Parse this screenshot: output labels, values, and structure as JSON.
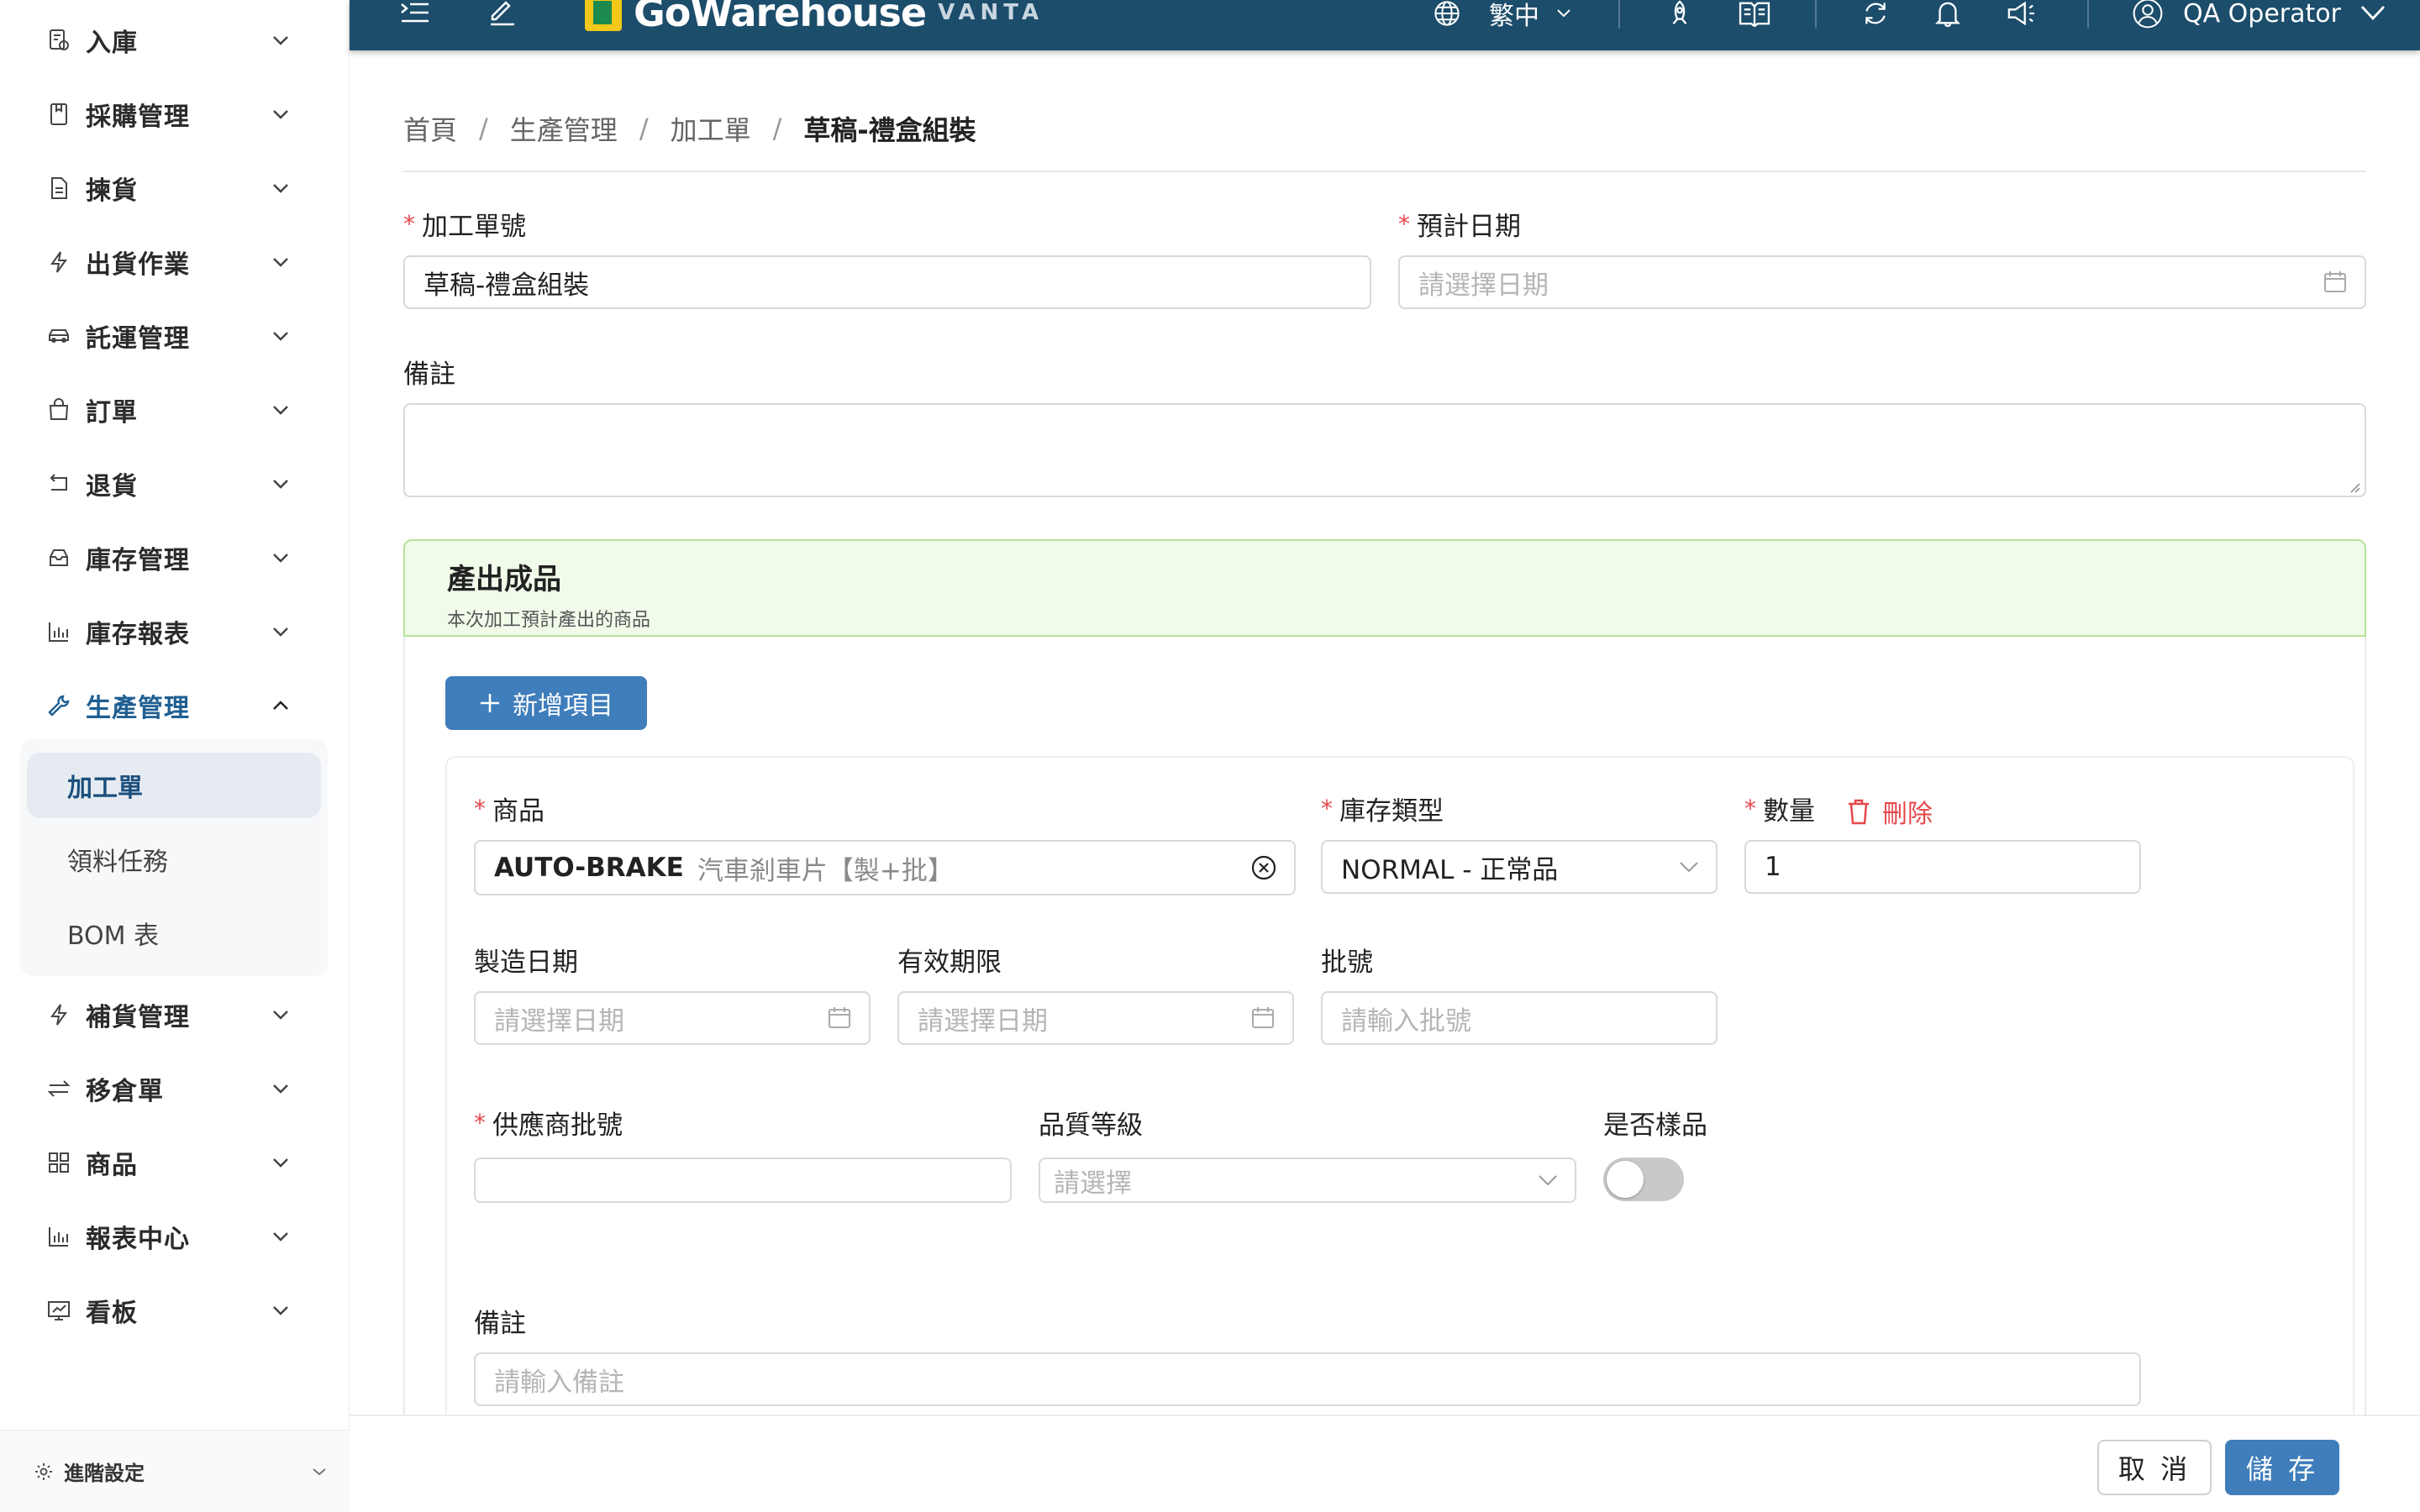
{
  "brand": {
    "name": "GoWarehouse",
    "sub": "VANTA"
  },
  "header": {
    "language": "繁中",
    "user": "QA Operator"
  },
  "sidebar": {
    "items": [
      {
        "label": "入庫",
        "icon": "inbound-icon"
      },
      {
        "label": "採購管理",
        "icon": "purchase-icon"
      },
      {
        "label": "揀貨",
        "icon": "picking-doc-icon"
      },
      {
        "label": "出貨作業",
        "icon": "lightning-icon"
      },
      {
        "label": "託運管理",
        "icon": "car-icon"
      },
      {
        "label": "訂單",
        "icon": "shopping-bag-icon"
      },
      {
        "label": "退貨",
        "icon": "return-icon"
      },
      {
        "label": "庫存管理",
        "icon": "inbox-icon"
      },
      {
        "label": "庫存報表",
        "icon": "bar-chart-icon"
      },
      {
        "label": "生產管理",
        "icon": "wrench-icon"
      },
      {
        "label": "補貨管理",
        "icon": "lightning-icon"
      },
      {
        "label": "移倉單",
        "icon": "swap-icon"
      },
      {
        "label": "商品",
        "icon": "grid-icon"
      },
      {
        "label": "報表中心",
        "icon": "bar-chart-icon"
      },
      {
        "label": "看板",
        "icon": "dashboard-icon"
      }
    ],
    "submenu": [
      "加工單",
      "領料任務",
      "BOM 表"
    ],
    "footer_label": "進階設定"
  },
  "breadcrumb": [
    "首頁",
    "生產管理",
    "加工單",
    "草稿-禮盒組裝"
  ],
  "form": {
    "order_no_label": "加工單號",
    "order_no_value": "草稿-禮盒組裝",
    "expected_date_label": "預計日期",
    "expected_date_placeholder": "請選擇日期",
    "remark_label": "備註"
  },
  "section": {
    "title": "產出成品",
    "desc": "本次加工預計產出的商品",
    "add_label": "新增項目"
  },
  "item": {
    "product_label": "商品",
    "product_sku": "AUTO-BRAKE",
    "product_name": "汽車剎車片【製+批】",
    "stock_type_label": "庫存類型",
    "stock_type_value": "NORMAL - 正常品",
    "qty_label": "數量",
    "qty_value": "1",
    "delete_label": "刪除",
    "mfg_date_label": "製造日期",
    "mfg_date_placeholder": "請選擇日期",
    "expiry_label": "有效期限",
    "expiry_placeholder": "請選擇日期",
    "batch_label": "批號",
    "batch_placeholder": "請輸入批號",
    "supplier_batch_label": "供應商批號",
    "quality_label": "品質等級",
    "quality_placeholder": "請選擇",
    "sample_label": "是否樣品",
    "remark_label": "備註",
    "remark_placeholder": "請輸入備註"
  },
  "footer": {
    "cancel": "取 消",
    "save": "儲 存"
  }
}
